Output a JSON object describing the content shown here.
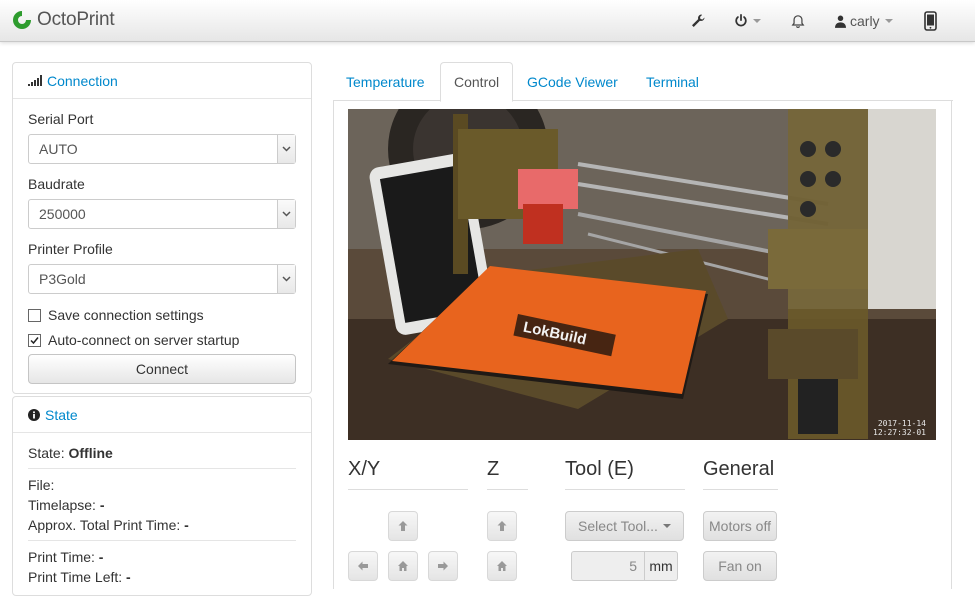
{
  "navbar": {
    "brand": "OctoPrint",
    "user": "carly",
    "icons": [
      "wrench-icon",
      "power-icon",
      "bell-icon",
      "user-icon",
      "mobile-icon"
    ]
  },
  "connection": {
    "title": "Connection",
    "serial_port_label": "Serial Port",
    "serial_port_value": "AUTO",
    "baudrate_label": "Baudrate",
    "baudrate_value": "250000",
    "profile_label": "Printer Profile",
    "profile_value": "P3Gold",
    "save_settings_label": "Save connection settings",
    "save_settings_checked": false,
    "autoconnect_label": "Auto-connect on server startup",
    "autoconnect_checked": true,
    "connect_button": "Connect"
  },
  "state": {
    "title": "State",
    "state_label": "State:",
    "state_value": "Offline",
    "file_label": "File:",
    "timelapse_label": "Timelapse:",
    "timelapse_value": "-",
    "approx_label": "Approx. Total Print Time:",
    "approx_value": "-",
    "print_time_label": "Print Time:",
    "print_time_value": "-",
    "print_time_left_label": "Print Time Left:",
    "print_time_left_value": "-"
  },
  "tabs": [
    {
      "label": "Temperature",
      "active": false
    },
    {
      "label": "Control",
      "active": true
    },
    {
      "label": "GCode Viewer",
      "active": false
    },
    {
      "label": "Terminal",
      "active": false
    }
  ],
  "webcam": {
    "timestamp_date": "2017-11-14",
    "timestamp_time": "12:27:32-01",
    "bed_brand": "LokBuild"
  },
  "control": {
    "xy_title": "X/Y",
    "z_title": "Z",
    "tool_title": "Tool (E)",
    "general_title": "General",
    "select_tool_label": "Select Tool...",
    "extrude_amount": "5",
    "extrude_unit": "mm",
    "motors_off_label": "Motors off",
    "fan_on_label": "Fan on"
  },
  "colors": {
    "link": "#0088cc",
    "brand_green": "#2e9c2e",
    "bed_orange": "#e8641e"
  }
}
